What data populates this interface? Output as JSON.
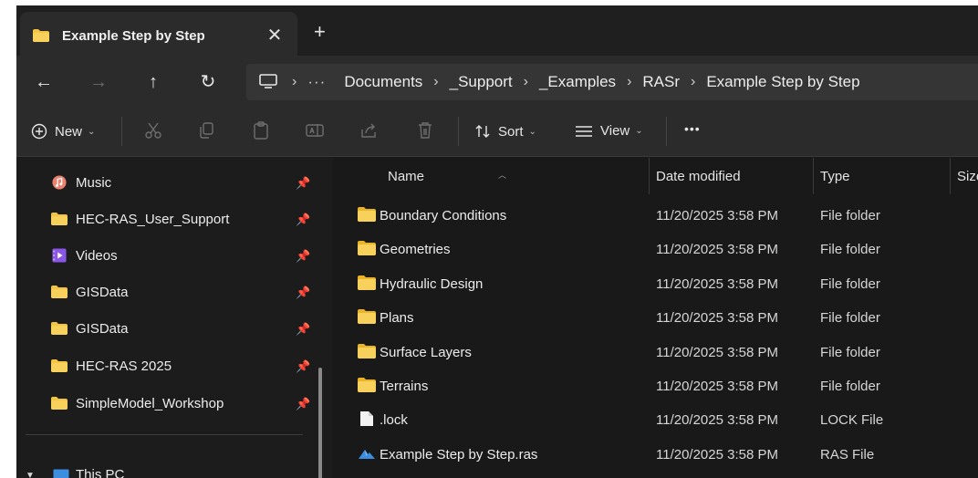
{
  "colors": {
    "folder": "#f4c542",
    "accent": "#3b8ee0",
    "window": "#191919",
    "toolbar": "#2b2b2b"
  },
  "tab": {
    "title": "Example Step by Step",
    "close_glyph": "✕",
    "new_tab_glyph": "+"
  },
  "nav": {
    "back": "←",
    "forward": "→",
    "up": "↑",
    "refresh": "↻"
  },
  "address": {
    "overflow": "···",
    "separator": "›",
    "crumbs": [
      "Documents",
      "_Support",
      "_Examples",
      "RASr",
      "Example Step by Step"
    ]
  },
  "toolbar": {
    "new_label": "New",
    "sort_label": "Sort",
    "view_label": "View",
    "more_glyph": "•••",
    "chevron": "⌄",
    "icons": [
      "plus-circle-icon",
      "cut-icon",
      "copy-icon",
      "paste-icon",
      "rename-icon",
      "share-icon",
      "delete-icon",
      "sort-icon",
      "view-icon"
    ]
  },
  "sidebar": {
    "pin_glyph": "📌",
    "items": [
      {
        "label": "Music",
        "icon": "music-icon"
      },
      {
        "label": "HEC-RAS_User_Support",
        "icon": "folder-icon"
      },
      {
        "label": "Videos",
        "icon": "videos-icon"
      },
      {
        "label": "GISData",
        "icon": "folder-icon"
      },
      {
        "label": "GISData",
        "icon": "folder-icon"
      },
      {
        "label": "HEC-RAS 2025",
        "icon": "folder-icon"
      },
      {
        "label": "SimpleModel_Workshop",
        "icon": "folder-icon"
      }
    ],
    "this_pc": "This PC"
  },
  "columns": {
    "name": "Name",
    "date": "Date modified",
    "type": "Type",
    "size": "Size"
  },
  "files": [
    {
      "name": "Boundary Conditions",
      "date": "11/20/2025 3:58 PM",
      "type": "File folder",
      "icon": "folder-icon"
    },
    {
      "name": "Geometries",
      "date": "11/20/2025 3:58 PM",
      "type": "File folder",
      "icon": "folder-icon"
    },
    {
      "name": "Hydraulic Design",
      "date": "11/20/2025 3:58 PM",
      "type": "File folder",
      "icon": "folder-icon"
    },
    {
      "name": "Plans",
      "date": "11/20/2025 3:58 PM",
      "type": "File folder",
      "icon": "folder-icon"
    },
    {
      "name": "Surface Layers",
      "date": "11/20/2025 3:58 PM",
      "type": "File folder",
      "icon": "folder-icon"
    },
    {
      "name": "Terrains",
      "date": "11/20/2025 3:58 PM",
      "type": "File folder",
      "icon": "folder-icon"
    },
    {
      "name": ".lock",
      "date": "11/20/2025 3:58 PM",
      "type": "LOCK File",
      "icon": "file-icon"
    },
    {
      "name": "Example Step by Step.ras",
      "date": "11/20/2025 3:58 PM",
      "type": "RAS File",
      "icon": "ras-file-icon"
    }
  ]
}
